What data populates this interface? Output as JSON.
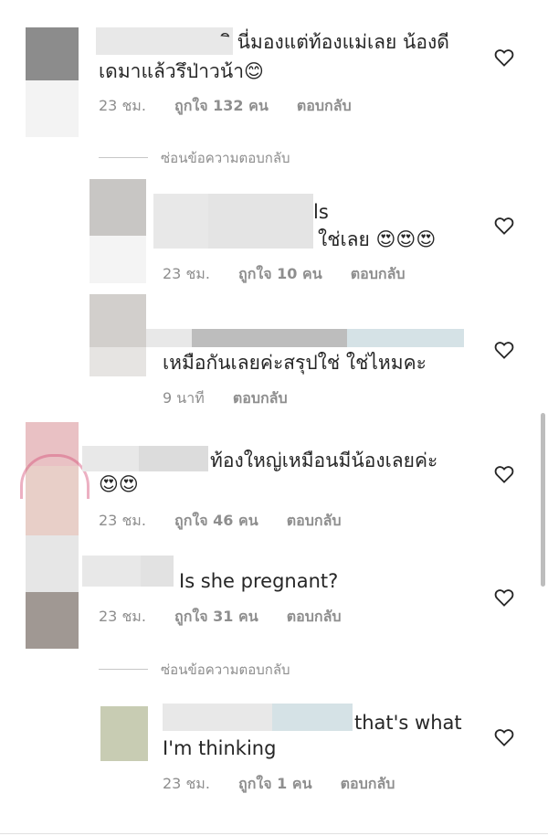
{
  "comments": [
    {
      "text_line1": "ิ นี่มองแต่ท้องแม่เลย น้องดี",
      "text_line2": "เดมาแล้วรึป่าวน้า😊",
      "time": "23 ชม.",
      "likes": "ถูกใจ 132 คน",
      "reply": "ตอบกลับ"
    },
    {
      "username_fragment": "ls",
      "text_line2": "ใช่เลย 😍😍😍",
      "time": "23 ชม.",
      "likes": "ถูกใจ 10 คน",
      "reply": "ตอบกลับ"
    },
    {
      "text_line2": "เหมือกันเลยค่ะสรุปใช่ ใช่ไหมคะ",
      "time": "9 นาที",
      "reply": "ตอบกลับ"
    },
    {
      "text_line1": "ท้องใหญ่เหมือนมีน้องเลยค่ะ",
      "text_line2": "😍😍",
      "time": "23 ชม.",
      "likes": "ถูกใจ 46 คน",
      "reply": "ตอบกลับ"
    },
    {
      "text_line1": "Is she pregnant?",
      "time": "23 ชม.",
      "likes": "ถูกใจ 31 คน",
      "reply": "ตอบกลับ"
    },
    {
      "text_line1": "that's what",
      "text_line2": "I'm thinking",
      "time": "23 ชม.",
      "likes": "ถูกใจ 1 คน",
      "reply": "ตอบกลับ"
    }
  ],
  "hide_replies": "ซ่อนข้อความตอบกลับ",
  "icons": {
    "like": "heart-outline-icon"
  },
  "colors": {
    "text": "#262626",
    "meta": "#8e8e8e",
    "divider": "#c7c7c7"
  }
}
